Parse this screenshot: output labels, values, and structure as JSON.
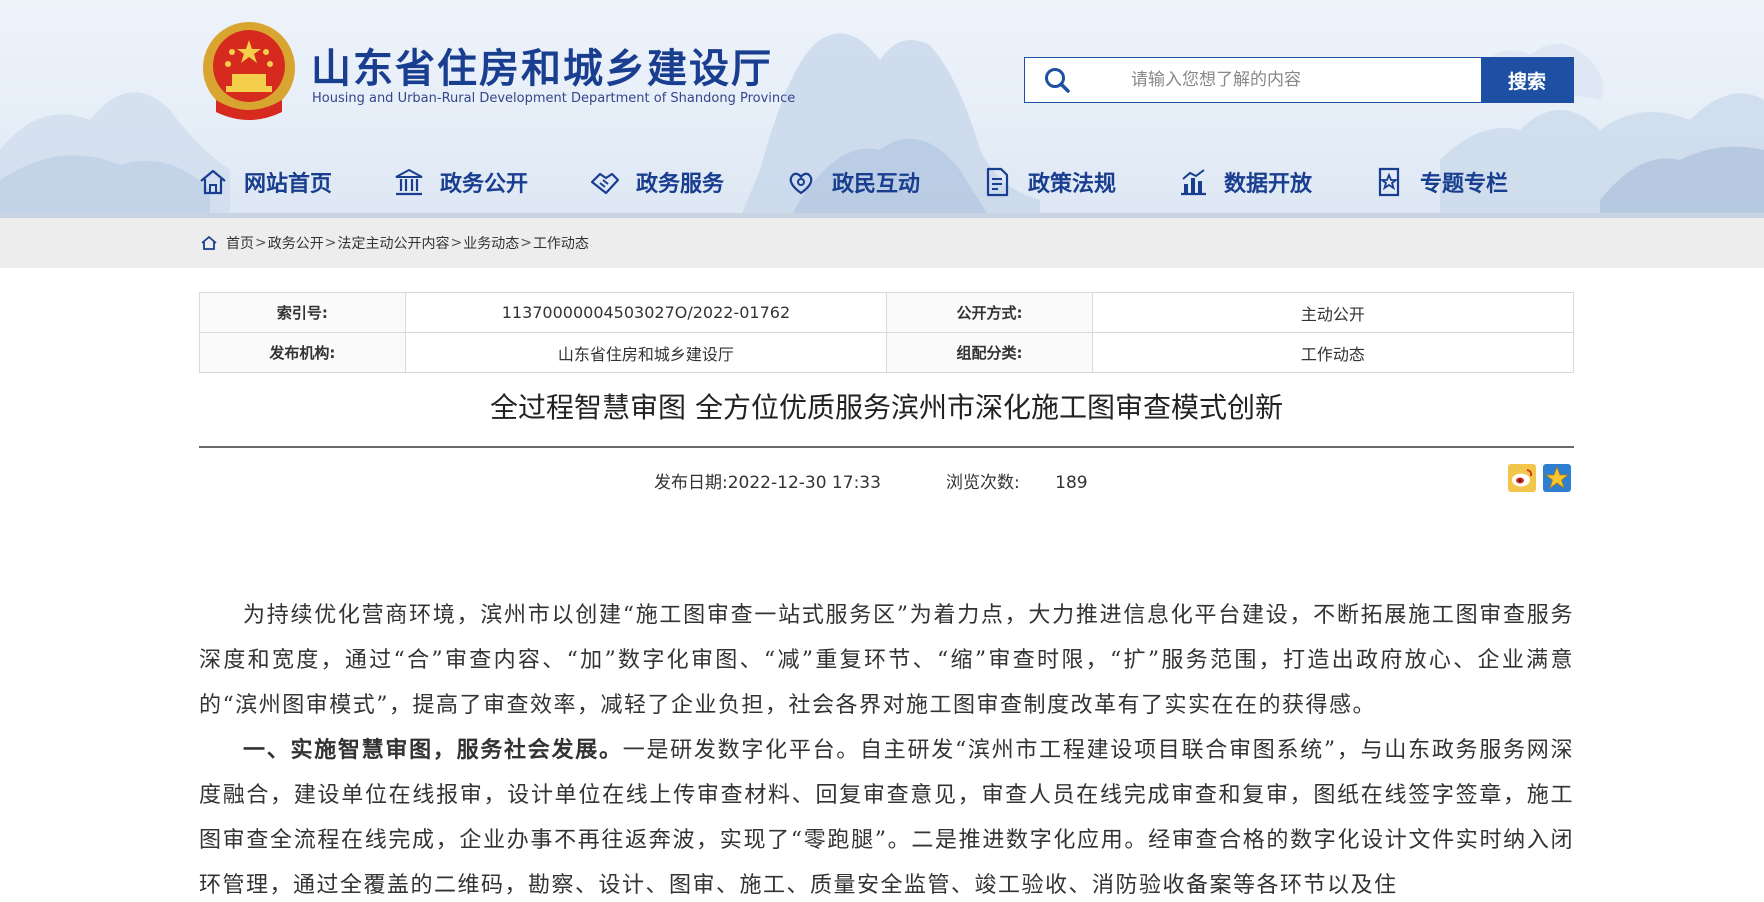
{
  "header": {
    "title": "山东省住房和城乡建设厅",
    "subtitle": "Housing and Urban-Rural Development Department of Shandong Province",
    "search_placeholder": "请输入您想了解的内容",
    "search_button": "搜索",
    "brand_color": "#1a3e8f"
  },
  "nav": {
    "items": [
      {
        "label": "网站首页",
        "icon": "home-icon"
      },
      {
        "label": "政务公开",
        "icon": "government-building-icon"
      },
      {
        "label": "政务服务",
        "icon": "handshake-icon"
      },
      {
        "label": "政民互动",
        "icon": "interaction-icon"
      },
      {
        "label": "政策法规",
        "icon": "policy-document-icon"
      },
      {
        "label": "数据开放",
        "icon": "bar-chart-icon"
      },
      {
        "label": "专题专栏",
        "icon": "topic-star-icon"
      }
    ]
  },
  "breadcrumb": {
    "items": [
      "首页",
      "政务公开",
      "法定主动公开内容",
      "业务动态",
      "工作动态"
    ],
    "separator": ">"
  },
  "meta": {
    "index_label": "索引号:",
    "index_value": "11370000004503027O/2022-01762",
    "open_mode_label": "公开方式:",
    "open_mode_value": "主动公开",
    "publisher_label": "发布机构:",
    "publisher_value": "山东省住房和城乡建设厅",
    "category_label": "组配分类:",
    "category_value": "工作动态"
  },
  "article": {
    "title": "全过程智慧审图 全方位优质服务滨州市深化施工图审查模式创新",
    "publish_date_label": "发布日期:",
    "publish_date": "2022-12-30 17:33",
    "views_label": "浏览次数:",
    "views": "189",
    "share_icons": [
      "weibo-share-icon",
      "favorite-star-icon"
    ],
    "paragraph1": "为持续优化营商环境，滨州市以创建“施工图审查一站式服务区”为着力点，大力推进信息化平台建设，不断拓展施工图审查服务深度和宽度，通过“合”审查内容、“加”数字化审图、“减”重复环节、“缩”审查时限，“扩”服务范围，打造出政府放心、企业满意的“滨州图审模式”，提高了审查效率，减轻了企业负担，社会各界对施工图审查制度改革有了实实在在的获得感。",
    "paragraph2_heading": "一、实施智慧审图，服务社会发展。",
    "paragraph2_body": "一是研发数字化平台。自主研发“滨州市工程建设项目联合审图系统”，与山东政务服务网深度融合，建设单位在线报审，设计单位在线上传审查材料、回复审查意见，审查人员在线完成审查和复审，图纸在线签字签章，施工图审查全流程在线完成，企业办事不再往返奔波，实现了“零跑腿”。二是推进数字化应用。经审查合格的数字化设计文件实时纳入闭环管理，通过全覆盖的二维码，勘察、设计、图审、施工、质量安全监管、竣工验收、消防验收备案等各环节以及住"
  }
}
